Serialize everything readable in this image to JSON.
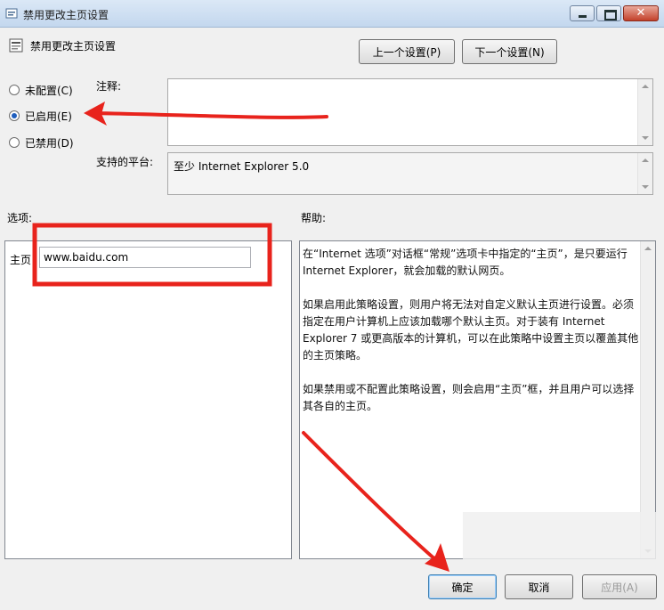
{
  "window": {
    "title": "禁用更改主页设置"
  },
  "header": {
    "policy_title": "禁用更改主页设置",
    "prev_button": "上一个设置(P)",
    "next_button": "下一个设置(N)"
  },
  "state": {
    "options": [
      {
        "label": "未配置(C)",
        "checked": false
      },
      {
        "label": "已启用(E)",
        "checked": true
      },
      {
        "label": "已禁用(D)",
        "checked": false
      }
    ]
  },
  "comment": {
    "label": "注释:"
  },
  "platform": {
    "label": "支持的平台:",
    "value": "至少 Internet Explorer 5.0"
  },
  "options_section": {
    "label": "选项:",
    "homepage_label": "主页",
    "homepage_value": "www.baidu.com"
  },
  "help_section": {
    "label": "帮助:",
    "paragraphs": [
      "在“Internet 选项”对话框“常规”选项卡中指定的“主页”，是只要运行 Internet Explorer，就会加载的默认网页。",
      "如果启用此策略设置，则用户将无法对自定义默认主页进行设置。必须指定在用户计算机上应该加载哪个默认主页。对于装有 Internet Explorer 7 或更高版本的计算机，可以在此策略中设置主页以覆盖其他的主页策略。",
      "如果禁用或不配置此策略设置，则会启用“主页”框，并且用户可以选择其各自的主页。"
    ]
  },
  "footer": {
    "ok": "确定",
    "cancel": "取消",
    "apply": "应用(A)"
  },
  "colors": {
    "annotation_red": "#e8231c",
    "radio_dot": "#1f5ebd"
  }
}
